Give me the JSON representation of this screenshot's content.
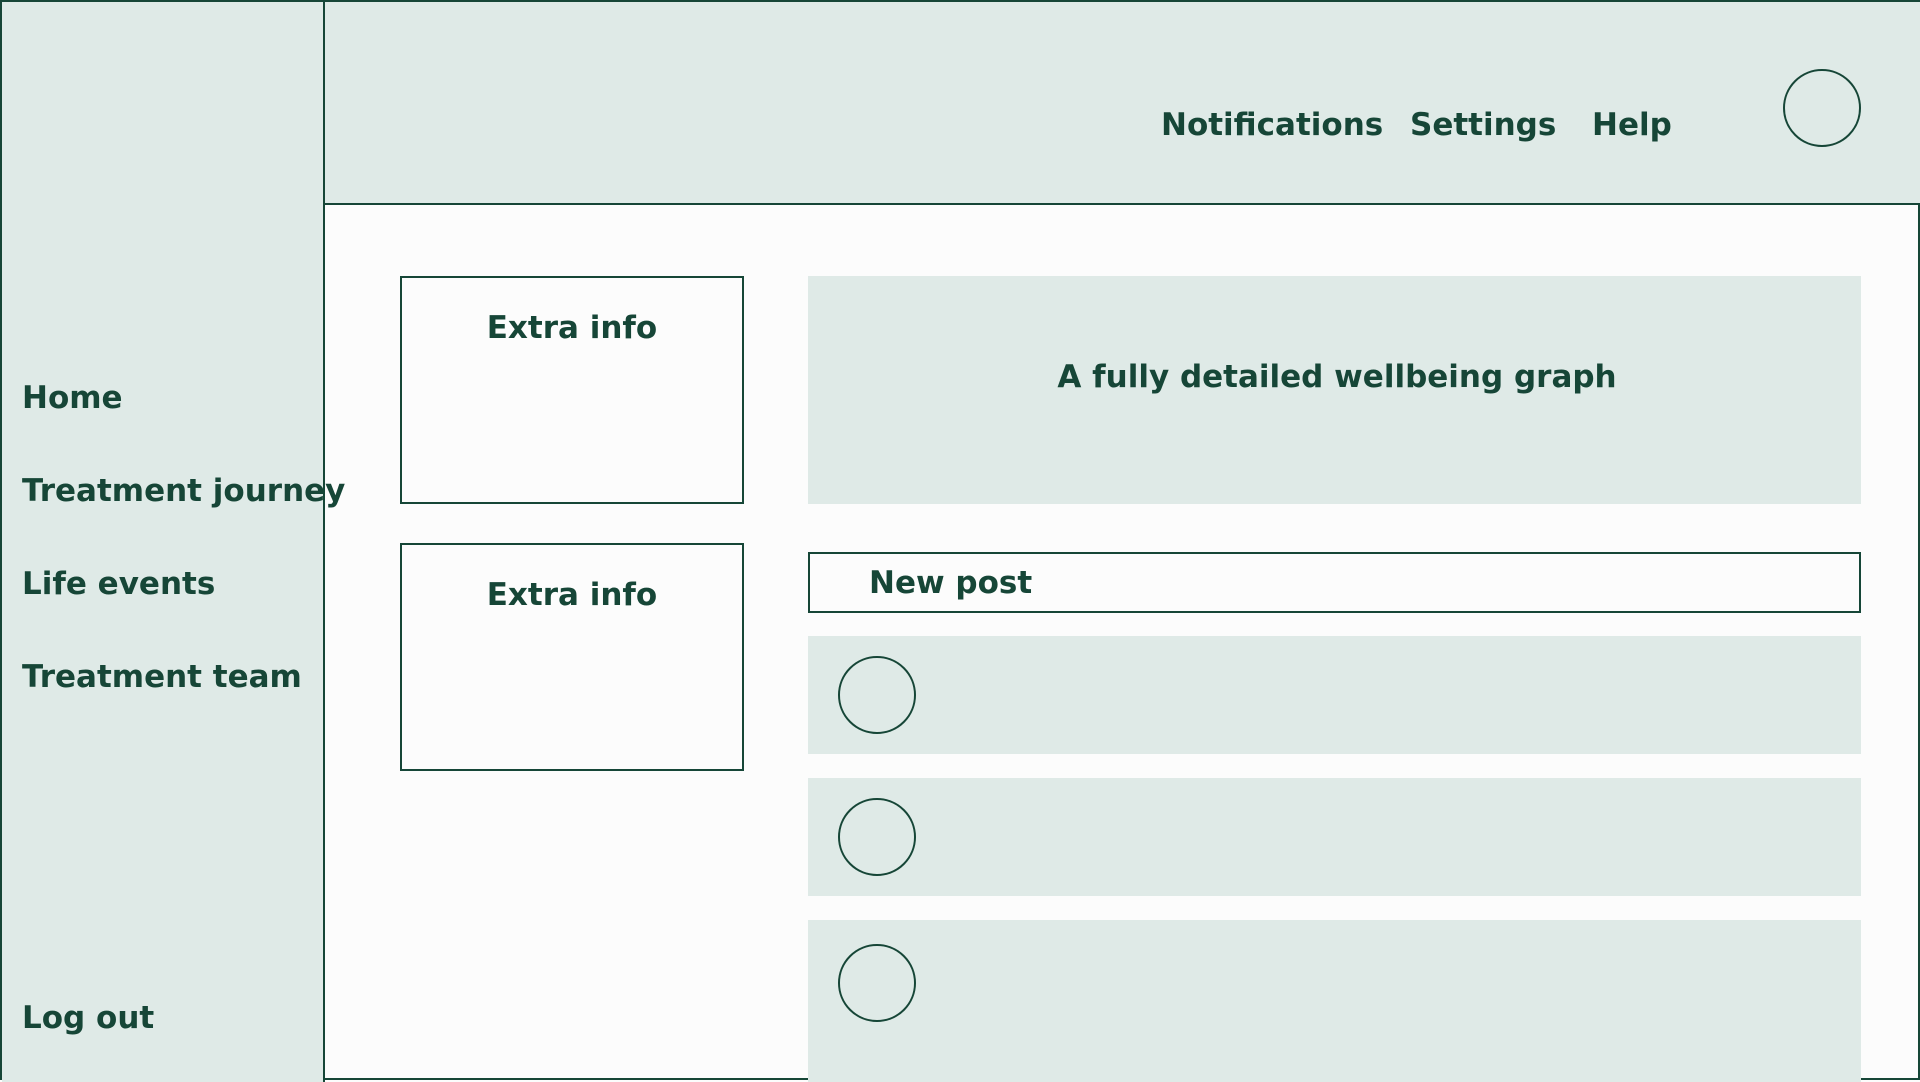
{
  "sidebar": {
    "items": [
      {
        "label": "Home"
      },
      {
        "label": "Treatment journey"
      },
      {
        "label": "Life events"
      },
      {
        "label": "Treatment team"
      }
    ],
    "logout_label": "Log out"
  },
  "header": {
    "links": [
      {
        "label": "Notifications"
      },
      {
        "label": "Settings"
      },
      {
        "label": "Help"
      }
    ],
    "profile_icon": "avatar-circle"
  },
  "main": {
    "info_cards": [
      {
        "title": "Extra info"
      },
      {
        "title": "Extra info"
      }
    ],
    "graph_placeholder": "A fully detailed wellbeing graph",
    "new_post_label": "New post",
    "posts": [
      {
        "avatar_icon": "avatar-circle"
      },
      {
        "avatar_icon": "avatar-circle"
      },
      {
        "avatar_icon": "avatar-circle"
      }
    ]
  },
  "colors": {
    "accent": "#164637",
    "panel": "#dfeae7",
    "background": "#fcfcfc"
  }
}
